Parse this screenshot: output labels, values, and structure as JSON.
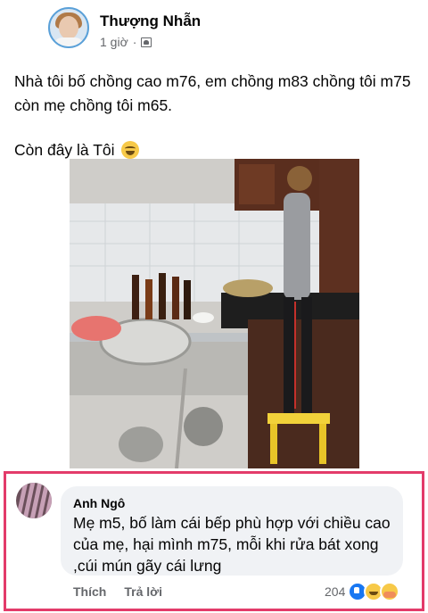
{
  "post": {
    "author": "Thượng Nhẫn",
    "time": "1 giờ",
    "separator": "·",
    "text_line1": "Nhà tôi bố chồng cao m76, em chồng m83 chồng tôi m75 còn mẹ chồng tôi m65.",
    "text_line2": "Còn đây là Tôi",
    "emoji": "laughing-face-emoji"
  },
  "comment": {
    "author": "Anh Ngô",
    "text": "Mẹ m5, bố làm cái bếp phù hợp với chiều cao của mẹ, hại mình m75, mỗi khi rửa bát xong ,cúi mún gãy cái lưng",
    "like_label": "Thích",
    "reply_label": "Trả lời",
    "reaction_count": "204"
  },
  "colors": {
    "highlight_border": "#e33b6a",
    "meta_text": "#65676b",
    "bubble_bg": "#f0f2f5",
    "like_blue": "#1877f2"
  }
}
